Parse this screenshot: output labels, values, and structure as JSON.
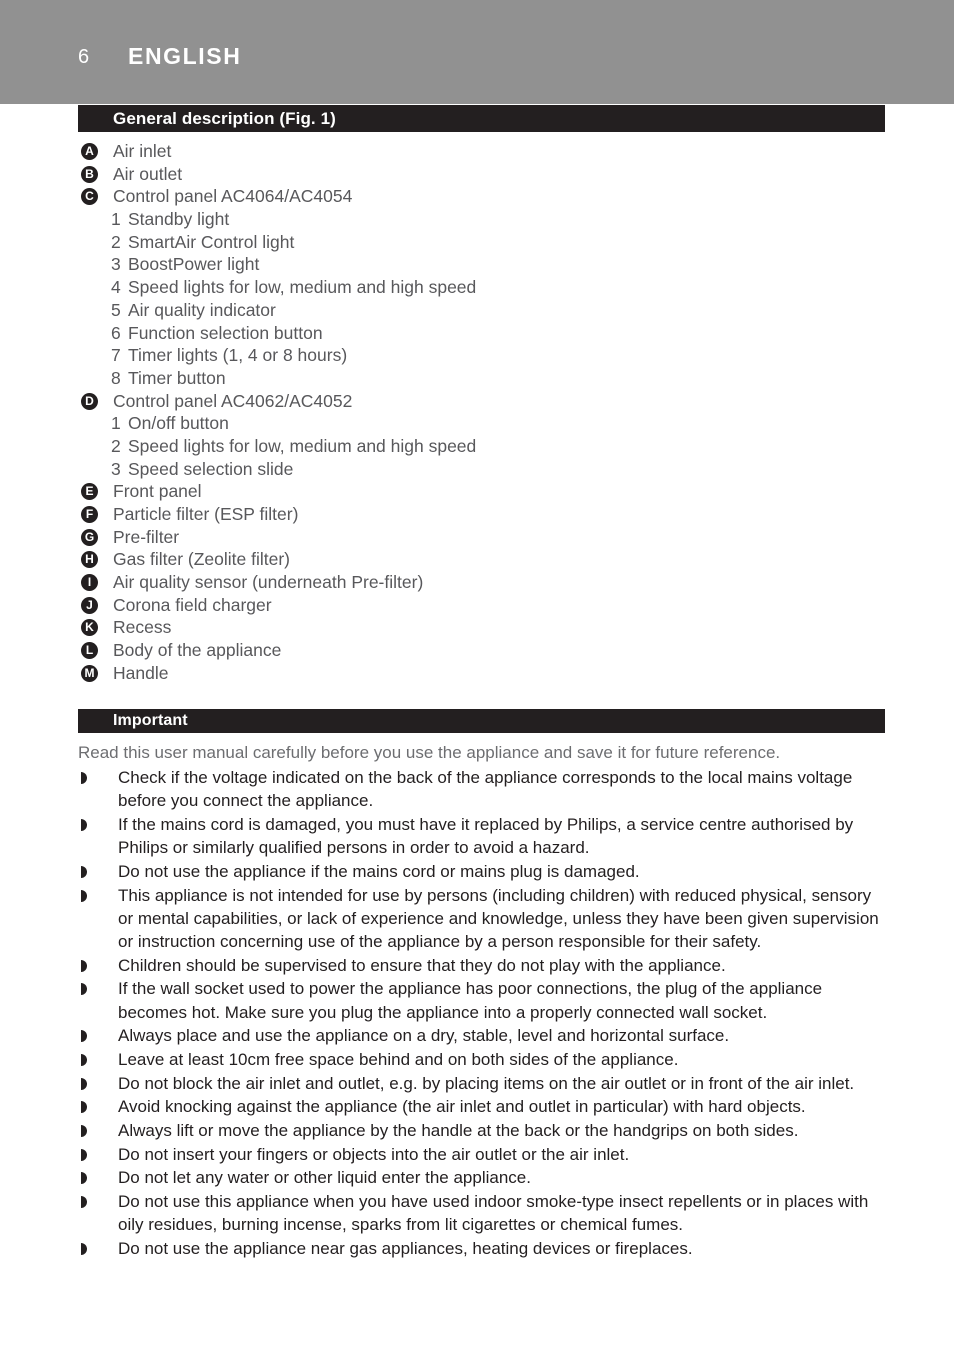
{
  "colors": {
    "header_band": "#919191",
    "section_bar": "#231f20",
    "body_text": "#231f20",
    "light_text": "#58585b",
    "intro_text": "#6d6e71",
    "white": "#ffffff"
  },
  "header": {
    "page_number": "6",
    "chapter": "ENGLISH"
  },
  "sections": {
    "general": {
      "bar_label": "General description (Fig. 1)",
      "items": [
        {
          "letter": "A",
          "label": "Air inlet",
          "sub": []
        },
        {
          "letter": "B",
          "label": "Air outlet",
          "sub": []
        },
        {
          "letter": "C",
          "label": "Control panel AC4064/AC4054",
          "sub": [
            {
              "num": "1",
              "label": "Standby light"
            },
            {
              "num": "2",
              "label": "SmartAir Control light"
            },
            {
              "num": "3",
              "label": "BoostPower light"
            },
            {
              "num": "4",
              "label": "Speed lights for low, medium and high speed"
            },
            {
              "num": "5",
              "label": "Air quality indicator"
            },
            {
              "num": "6",
              "label": "Function selection button"
            },
            {
              "num": "7",
              "label": "Timer lights (1, 4 or 8 hours)"
            },
            {
              "num": "8",
              "label": "Timer button"
            }
          ]
        },
        {
          "letter": "D",
          "label": "Control panel AC4062/AC4052",
          "sub": [
            {
              "num": "1",
              "label": "On/off button"
            },
            {
              "num": "2",
              "label": "Speed lights for low, medium and high speed"
            },
            {
              "num": "3",
              "label": "Speed selection slide"
            }
          ]
        },
        {
          "letter": "E",
          "label": "Front panel",
          "sub": []
        },
        {
          "letter": "F",
          "label": "Particle filter (ESP filter)",
          "sub": []
        },
        {
          "letter": "G",
          "label": "Pre-filter",
          "sub": []
        },
        {
          "letter": "H",
          "label": "Gas filter (Zeolite filter)",
          "sub": []
        },
        {
          "letter": "I",
          "label": "Air quality sensor (underneath Pre-filter)",
          "sub": []
        },
        {
          "letter": "J",
          "label": "Corona field charger",
          "sub": []
        },
        {
          "letter": "K",
          "label": "Recess",
          "sub": []
        },
        {
          "letter": "L",
          "label": "Body of the appliance",
          "sub": []
        },
        {
          "letter": "M",
          "label": "Handle",
          "sub": []
        }
      ]
    },
    "important": {
      "bar_label": "Important",
      "intro": "Read this user manual carefully before you use the appliance and save it for future reference.",
      "bullets": [
        "Check if the voltage indicated on the back of the appliance corresponds to the local mains voltage before you connect the appliance.",
        "If the mains cord is damaged, you must have it replaced by Philips, a service centre authorised by Philips or similarly qualified persons in order to avoid a hazard.",
        "Do not use the appliance if the mains cord or mains plug is damaged.",
        "This appliance is not intended for use by persons (including children) with reduced physical, sensory or mental capabilities, or lack of experience and knowledge, unless they have been given supervision or instruction concerning use of the appliance by a person responsible for their safety.",
        "Children should be supervised to ensure that they do not play with the appliance.",
        "If the wall socket used to power the appliance has poor connections, the plug of the appliance becomes hot. Make sure you plug the appliance into a properly connected wall socket.",
        "Always place and use the appliance on a dry, stable, level and horizontal surface.",
        "Leave at least 10cm free space behind and on both sides of the appliance.",
        "Do not block the air inlet and outlet, e.g. by placing items on the air outlet or in front of the air inlet.",
        "Avoid knocking against the appliance (the air inlet and outlet in particular) with hard objects.",
        "Always lift or move the appliance by the handle at the back or the handgrips on both sides.",
        "Do not insert your fingers or objects into the air outlet or the air inlet.",
        "Do not let any water or other liquid enter the appliance.",
        "Do not use this appliance when you have used indoor smoke-type insect repellents or in places with oily residues, burning incense, sparks from lit cigarettes or chemical fumes.",
        "Do not use the appliance near gas appliances, heating devices or fireplaces."
      ]
    }
  }
}
